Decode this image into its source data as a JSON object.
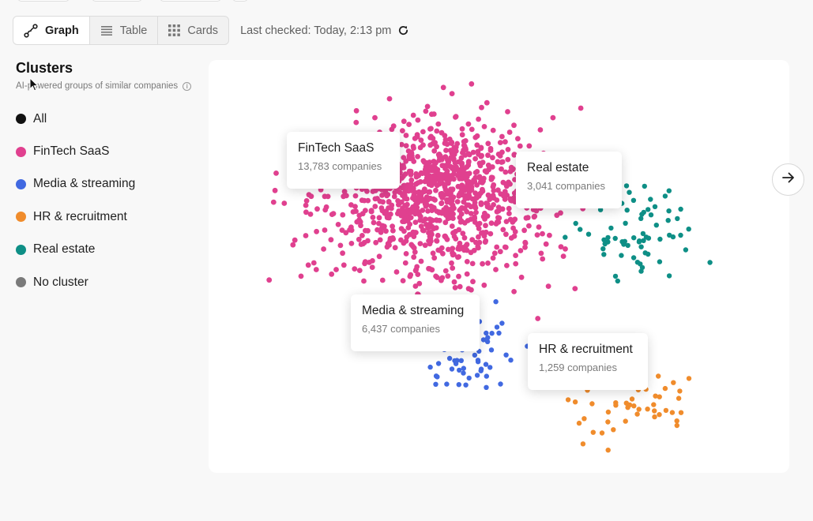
{
  "toolbar": {
    "views": [
      {
        "label": "Graph",
        "icon": "graph-icon",
        "active": true
      },
      {
        "label": "Table",
        "icon": "table-icon",
        "active": false
      },
      {
        "label": "Cards",
        "icon": "grid-icon",
        "active": false
      }
    ],
    "last_checked": "Last checked: Today, 2:13 pm"
  },
  "sidebar": {
    "title": "Clusters",
    "subtitle": "AI-powered groups of similar companies",
    "items": [
      {
        "label": "All",
        "color": "#111111"
      },
      {
        "label": "FinTech SaaS",
        "color": "#e0408f"
      },
      {
        "label": "Media & streaming",
        "color": "#4169e1"
      },
      {
        "label": "HR & recruitment",
        "color": "#f08c2c"
      },
      {
        "label": "Real estate",
        "color": "#0e8f86"
      },
      {
        "label": "No cluster",
        "color": "#7a7a7a"
      }
    ]
  },
  "clusters": {
    "fintech": {
      "name": "FinTech SaaS",
      "count": "13,783 companies",
      "color": "#e0408f"
    },
    "realestate": {
      "name": "Real estate",
      "count": "3,041 companies",
      "color": "#0e8f86"
    },
    "media": {
      "name": "Media & streaming",
      "count": "6,437 companies",
      "color": "#4169e1"
    },
    "hr": {
      "name": "HR & recruitment",
      "count": "1,259 companies",
      "color": "#f08c2c"
    }
  }
}
